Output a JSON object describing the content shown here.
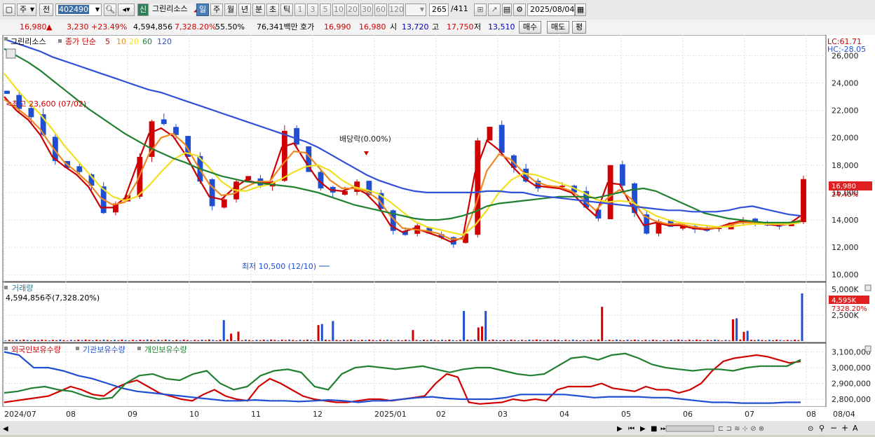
{
  "toolbar": {
    "period_selector": "주",
    "prev_label": "전",
    "code": "402490",
    "new_badge": "신",
    "stock_name": "그린리소스",
    "tabs": [
      "일",
      "주",
      "월",
      "년",
      "분",
      "초",
      "틱"
    ],
    "active_tab": "일",
    "intervals": [
      "1",
      "3",
      "5",
      "10",
      "20",
      "30",
      "60",
      "120"
    ],
    "count_display": "265",
    "count_total": "/411",
    "date": "2025/08/04"
  },
  "quote": {
    "price": "16,980",
    "arrow": "▲",
    "change": "3,230",
    "change_pct": "+23.49%",
    "volume": "4,594,856",
    "volume_ratio": "7,328.20%",
    "turnover": "55.50%",
    "trade_value": "76,341백만",
    "hoga_label": "호가",
    "ask": "16,990",
    "bid": "16,980",
    "open_label": "시",
    "open": "13,720",
    "high_label": "고",
    "high": "17,750",
    "low_label": "저",
    "low": "13,510",
    "buy_label": "매수",
    "sell_label": "매도",
    "avg_label": "평"
  },
  "price_panel": {
    "legend_name": "그린리소스",
    "legend_ma_label": "종가 단순",
    "legend_ma_periods": [
      "5",
      "10",
      "20",
      "60",
      "120"
    ],
    "lc_label": "LC:61.71",
    "hc_label": "HC:-28.05",
    "high_annotation": "최고 23,600 (07/02)",
    "low_annotation": "최저 10,500 (12/10)",
    "dividend_annotation": "배당락(0.00%)",
    "last_price_tag": "16,980",
    "last_change_tag": "24.40%"
  },
  "volume_panel": {
    "title": "거래량",
    "info": "4,594,856주(7,328.20%)",
    "last_tag": "4,595K",
    "last_pct_tag": "7328.20%",
    "axis_ticks": [
      "5,000K",
      "2,500K"
    ]
  },
  "holdings_panel": {
    "legend": [
      "외국인보유수량",
      "기관보유수량",
      "개인보유수량"
    ],
    "axis_ticks": [
      "3,100,000",
      "3,000,000",
      "2,900,000",
      "2,800,000"
    ]
  },
  "x_axis": {
    "labels": [
      "2024/07",
      "08",
      "09",
      "10",
      "11",
      "12",
      "2025/01",
      "02",
      "03",
      "04",
      "05",
      "06",
      "07",
      "08",
      "08/04"
    ]
  },
  "colors": {
    "up": "#d00000",
    "down": "#1f4fd0",
    "ma5": "#cc0000",
    "ma10": "#ee8822",
    "ma20": "#f0e020",
    "ma60": "#208030",
    "ma120": "#3050d8"
  },
  "chart_data": {
    "type": "candlestick",
    "title": "그린리소스",
    "y_ticks": [
      10000,
      12000,
      14000,
      16000,
      18000,
      20000,
      22000,
      24000,
      26000
    ],
    "ylim": [
      9500,
      27500
    ],
    "grid": true,
    "series": [
      {
        "name": "종가",
        "values": [
          23200,
          22100,
          21500,
          20200,
          18300,
          17800,
          17500,
          16500,
          14500,
          15200,
          15800,
          18600,
          21200,
          21000,
          20200,
          18600,
          16800,
          15000,
          15500,
          16800,
          17200,
          16500,
          16800,
          20500,
          19500,
          17500,
          16300,
          16000,
          16100,
          16800,
          15800,
          14800,
          13200,
          12900,
          13600,
          13000,
          12700,
          12200,
          13000,
          19800,
          20800,
          18900,
          17800,
          16800,
          16300,
          16500,
          16500,
          16000,
          14900,
          14100,
          18000,
          16500,
          14500,
          13000,
          13900,
          13500,
          13600,
          13300,
          13200,
          13400,
          13800,
          14000,
          13800,
          13600,
          13500,
          13700,
          16980
        ]
      },
      {
        "name": "5",
        "values": [
          23000,
          22000,
          21300,
          20200,
          18600,
          17900,
          17300,
          16400,
          14900,
          14900,
          15600,
          18000,
          20300,
          20700,
          20100,
          18800,
          17200,
          15700,
          15500,
          16300,
          16900,
          16700,
          16700,
          19300,
          19600,
          18200,
          16900,
          16200,
          16100,
          16400,
          15900,
          15000,
          13600,
          13100,
          13400,
          13100,
          12800,
          12400,
          12700,
          17400,
          19800,
          19100,
          18000,
          17100,
          16500,
          16400,
          16300,
          16000,
          15100,
          14300,
          16700,
          16600,
          15000,
          13600,
          13800,
          13600,
          13600,
          13400,
          13300,
          13400,
          13700,
          13900,
          13800,
          13700,
          13600,
          13700,
          14300
        ]
      },
      {
        "name": "10",
        "values": [
          22800,
          22200,
          21500,
          20600,
          19300,
          18200,
          17500,
          16700,
          15600,
          15100,
          15300,
          16800,
          18800,
          20000,
          20300,
          19500,
          18000,
          16600,
          15800,
          15900,
          16400,
          16800,
          16800,
          18000,
          19000,
          18900,
          17900,
          16900,
          16300,
          16300,
          16100,
          15500,
          14300,
          13400,
          13300,
          13200,
          13000,
          12600,
          12600,
          14900,
          17600,
          18800,
          18400,
          17500,
          16800,
          16500,
          16400,
          16100,
          15500,
          14700,
          15600,
          16200,
          15500,
          14300,
          13900,
          13700,
          13700,
          13500,
          13400,
          13400,
          13600,
          13800,
          13800,
          13700,
          13700,
          13700,
          14000
        ]
      },
      {
        "name": "20",
        "values": [
          24700,
          23600,
          22600,
          21700,
          20600,
          19400,
          18400,
          17400,
          16400,
          15700,
          15400,
          15700,
          16500,
          17500,
          18400,
          18900,
          18700,
          17800,
          16800,
          16200,
          16100,
          16400,
          16600,
          17000,
          17500,
          17900,
          18000,
          17600,
          16900,
          16400,
          16200,
          15900,
          15300,
          14600,
          13900,
          13500,
          13300,
          13100,
          12900,
          13600,
          14700,
          16000,
          16900,
          17400,
          17300,
          17000,
          16700,
          16400,
          16000,
          15500,
          15300,
          15400,
          15300,
          14800,
          14300,
          14000,
          13800,
          13700,
          13600,
          13500,
          13500,
          13600,
          13700,
          13700,
          13700,
          13700,
          13800
        ]
      },
      {
        "name": "60",
        "values": [
          26500,
          26000,
          25500,
          24900,
          24200,
          23500,
          22800,
          22100,
          21500,
          20900,
          20300,
          19800,
          19300,
          18900,
          18500,
          18200,
          17800,
          17500,
          17200,
          17000,
          16800,
          16700,
          16600,
          16500,
          16400,
          16200,
          16000,
          15700,
          15400,
          15100,
          14900,
          14700,
          14500,
          14300,
          14100,
          14000,
          14000,
          14100,
          14300,
          14600,
          15000,
          15200,
          15300,
          15400,
          15500,
          15600,
          15700,
          15700,
          15700,
          15600,
          15800,
          16000,
          16200,
          16300,
          16100,
          15700,
          15300,
          14900,
          14500,
          14300,
          14100,
          14000,
          13900,
          13800,
          13800,
          13800,
          13900
        ]
      },
      {
        "name": "120",
        "values": [
          27200,
          26900,
          26600,
          26300,
          25900,
          25600,
          25300,
          25000,
          24700,
          24400,
          24100,
          23800,
          23500,
          23300,
          23000,
          22700,
          22400,
          22100,
          21800,
          21500,
          21200,
          20900,
          20600,
          20300,
          20000,
          19700,
          19300,
          18800,
          18300,
          17800,
          17300,
          16900,
          16600,
          16300,
          16100,
          16000,
          16000,
          16000,
          16000,
          16000,
          16100,
          16100,
          16000,
          16000,
          15800,
          15700,
          15600,
          15500,
          15400,
          15300,
          15200,
          15100,
          15000,
          14900,
          14800,
          14700,
          14700,
          14600,
          14600,
          14600,
          14700,
          14900,
          15000,
          14800,
          14600,
          14400,
          14300
        ]
      }
    ],
    "volume_series": {
      "name": "거래량",
      "unit": "K",
      "ylim": [
        0,
        5200
      ],
      "last_value": 4595
    },
    "holdings_series": [
      {
        "name": "외국인보유수량",
        "ylim": [
          2760000,
          3120000
        ],
        "values": [
          2780000,
          2790000,
          2800000,
          2810000,
          2820000,
          2850000,
          2880000,
          2860000,
          2830000,
          2820000,
          2870000,
          2900000,
          2920000,
          2880000,
          2840000,
          2820000,
          2800000,
          2790000,
          2830000,
          2860000,
          2820000,
          2800000,
          2790000,
          2880000,
          2930000,
          2900000,
          2860000,
          2820000,
          2800000,
          2790000,
          2780000,
          2780000,
          2790000,
          2800000,
          2800000,
          2790000,
          2800000,
          2810000,
          2820000,
          2900000,
          2960000,
          2940000,
          2780000,
          2770000,
          2775000,
          2780000,
          2800000,
          2790000,
          2800000,
          2790000,
          2860000,
          2880000,
          2880000,
          2880000,
          2900000,
          2870000,
          2860000,
          2850000,
          2880000,
          2860000,
          2860000,
          2840000,
          2860000,
          2900000,
          2980000,
          3040000,
          3060000,
          3070000,
          3080000,
          3070000,
          3050000,
          3030000,
          3040000
        ]
      },
      {
        "name": "기관보유수량",
        "ylim": [
          2760000,
          3120000
        ],
        "values": [
          3100000,
          3080000,
          3000000,
          3000000,
          2980000,
          2950000,
          2930000,
          2900000,
          2870000,
          2850000,
          2840000,
          2830000,
          2820000,
          2810000,
          2800000,
          2790000,
          2790000,
          2795000,
          2790000,
          2790000,
          2785000,
          2790000,
          2795000,
          2790000,
          2780000,
          2790000,
          2790000,
          2800000,
          2810000,
          2815000,
          2805000,
          2800000,
          2800000,
          2800000,
          2810000,
          2830000,
          2830000,
          2830000,
          2830000,
          2820000,
          2810000,
          2815000,
          2815000,
          2815000,
          2810000,
          2810000,
          2800000,
          2790000,
          2780000,
          2780000,
          2775000,
          2775000,
          2775000,
          2780000,
          2780000
        ]
      },
      {
        "name": "개인보유수량",
        "ylim": [
          2760000,
          3120000
        ],
        "values": [
          2840000,
          2850000,
          2870000,
          2880000,
          2860000,
          2850000,
          2820000,
          2800000,
          2810000,
          2900000,
          2950000,
          2960000,
          2930000,
          2920000,
          2960000,
          2980000,
          2900000,
          2860000,
          2880000,
          2950000,
          2980000,
          2990000,
          2970000,
          2880000,
          2860000,
          2960000,
          3000000,
          3010000,
          3000000,
          2990000,
          3000000,
          3010000,
          2990000,
          2970000,
          2990000,
          3000000,
          3000000,
          2980000,
          2960000,
          2950000,
          2960000,
          3010000,
          3060000,
          3070000,
          3050000,
          3080000,
          3090000,
          3060000,
          3020000,
          3000000,
          2990000,
          2980000,
          2990000,
          2990000,
          2980000,
          3000000,
          3010000,
          3010000,
          3010000,
          3050000
        ]
      }
    ]
  }
}
